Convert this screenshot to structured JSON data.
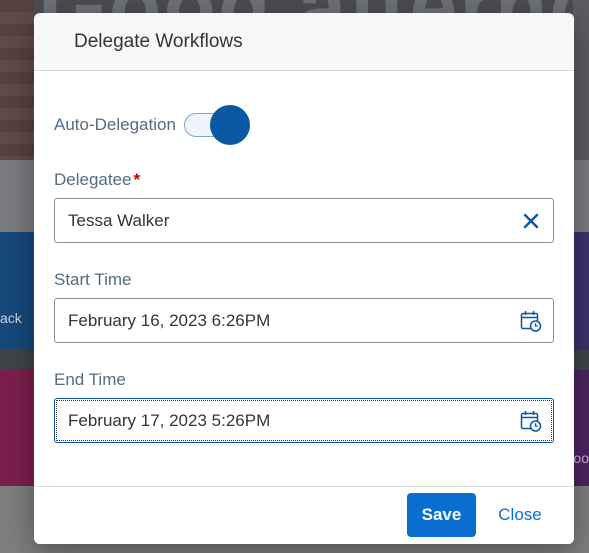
{
  "background": {
    "greeting": "Good afternoon!",
    "tile_left_text": "ack",
    "tile_right_text": "oo"
  },
  "dialog": {
    "title": "Delegate Workflows",
    "auto_delegation": {
      "label": "Auto-Delegation",
      "enabled": true
    },
    "delegatee": {
      "label": "Delegatee",
      "required_mark": "*",
      "value": "Tessa Walker",
      "clear_icon": "close-icon"
    },
    "start_time": {
      "label": "Start Time",
      "value": "February 16, 2023 6:26PM",
      "icon": "calendar-clock-icon"
    },
    "end_time": {
      "label": "End Time",
      "value": "February 17, 2023 5:26PM",
      "icon": "calendar-clock-icon"
    },
    "footer": {
      "save_label": "Save",
      "close_label": "Close"
    }
  },
  "colors": {
    "accent": "#0a6ed1",
    "toggle_knob": "#0a57a4",
    "label_text": "#556b82",
    "required": "#bb0000"
  }
}
